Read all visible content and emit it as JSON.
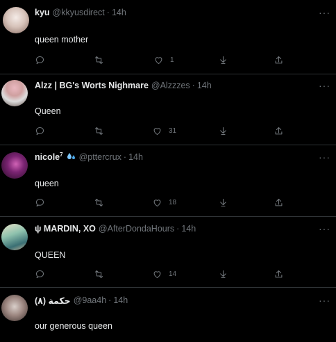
{
  "tweets": [
    {
      "name": "kyu",
      "name_sup": "",
      "handle": "@kkyusdirect",
      "time": "14h",
      "text": "queen mother",
      "reply_count": "",
      "retweet_count": "",
      "like_count": "1",
      "avatar_colors": [
        "#f2e6e1",
        "#b8998d"
      ]
    },
    {
      "name": "Alzz | BG's Worts Nighmare",
      "name_sup": "",
      "handle": "@Alzzzes",
      "time": "14h",
      "text": "Queen",
      "reply_count": "",
      "retweet_count": "",
      "like_count": "31",
      "avatar_colors": [
        "#e8c4c9",
        "#7b5f5a"
      ]
    },
    {
      "name": "nicole",
      "name_sup": "7",
      "handle": "@pttercrux",
      "time": "14h",
      "text": "queen",
      "reply_count": "",
      "retweet_count": "",
      "like_count": "18",
      "avatar_colors": [
        "#5a1c54",
        "#c64aa8"
      ]
    },
    {
      "name": "ψ MARDIN, XO",
      "name_sup": "",
      "handle": "@AfterDondaHours",
      "time": "14h",
      "text": "QUEEN",
      "reply_count": "",
      "retweet_count": "",
      "like_count": "14",
      "avatar_colors": [
        "#7fb3a0",
        "#d6d0a8"
      ]
    },
    {
      "name": "(٨) حكمة",
      "name_sup": "",
      "handle": "@9aa4h",
      "time": "14h",
      "text": "our generous queen",
      "reply_count": "",
      "retweet_count": "",
      "like_count": "",
      "avatar_colors": [
        "#cfc4bf",
        "#5c4a45"
      ]
    }
  ],
  "more_glyph": "···",
  "dot_separator": "·",
  "icons": {
    "reply": "reply-icon",
    "retweet": "retweet-icon",
    "like": "like-icon",
    "download": "download-icon",
    "share": "share-icon",
    "verified_extra": "droplets-emoji-icon"
  }
}
